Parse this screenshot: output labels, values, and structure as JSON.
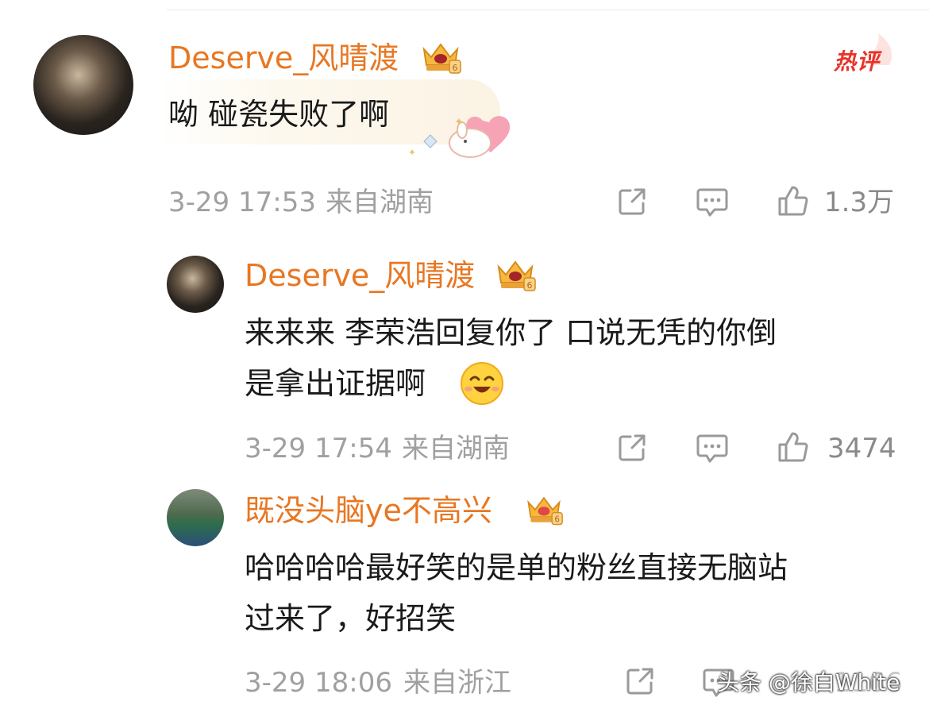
{
  "hot_badge": "热评",
  "comments": [
    {
      "username": "Deserve_风晴渡",
      "lines": [
        "呦 碰瓷失败了啊"
      ],
      "date": "3-29 17:53",
      "location": "来自湖南",
      "likes": "1.3万"
    },
    {
      "username": "Deserve_风晴渡",
      "lines": [
        "来来来 李荣浩回复你了 口说无凭的你倒",
        "是拿出证据啊"
      ],
      "date": "3-29 17:54",
      "location": "来自湖南",
      "likes": "3474"
    },
    {
      "username": "既没头脑ye不高兴",
      "lines": [
        "哈哈哈哈最好笑的是单的粉丝直接无脑站",
        "过来了，好招笑"
      ],
      "date": "3-29 18:06",
      "location": "来自浙江",
      "likes": "1166"
    }
  ],
  "watermark": "头条 @徐白White",
  "colors": {
    "username": "#e87722",
    "hot": "#e8332a",
    "meta": "#a0a0a0"
  }
}
